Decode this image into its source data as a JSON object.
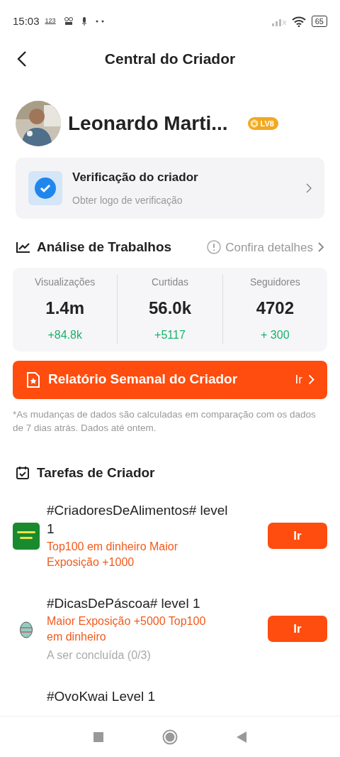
{
  "status_bar": {
    "time": "15:03",
    "indicator": "123",
    "battery": "65"
  },
  "header": {
    "title": "Central do Criador"
  },
  "profile": {
    "name": "Leonardo Marti...",
    "badge": "LV8"
  },
  "verification": {
    "title": "Verificação do criador",
    "subtitle": "Obter logo de verificação"
  },
  "analysis": {
    "title": "Análise de Trabalhos",
    "details_link": "Confira detalhes",
    "stats": [
      {
        "label": "Visualizações",
        "value": "1.4m",
        "change": "+84.8k"
      },
      {
        "label": "Curtidas",
        "value": "56.0k",
        "change": "+5117"
      },
      {
        "label": "Seguidores",
        "value": "4702",
        "change": "+ 300"
      }
    ]
  },
  "weekly_report": {
    "label": "Relatório Semanal do Criador",
    "action": "Ir"
  },
  "note": "*As mudanças de dados são calculadas em comparação com os dados de 7 dias atrás. Dados até ontem.",
  "tasks": {
    "title": "Tarefas de Criador",
    "items": [
      {
        "kind": "banner",
        "title": "#CriadoresDeAlimentos# level 1",
        "reward": "Top100 em dinheiro Maior Exposição +1000",
        "button": "Ir"
      },
      {
        "kind": "egg",
        "title": "#DicasDePáscoa# level 1",
        "reward": "Maior Exposição +5000 Top100 em dinheiro",
        "progress": "A ser concluída (0/3)",
        "button": "Ir"
      },
      {
        "kind": "none",
        "title": "#OvoKwai Level 1"
      }
    ]
  }
}
